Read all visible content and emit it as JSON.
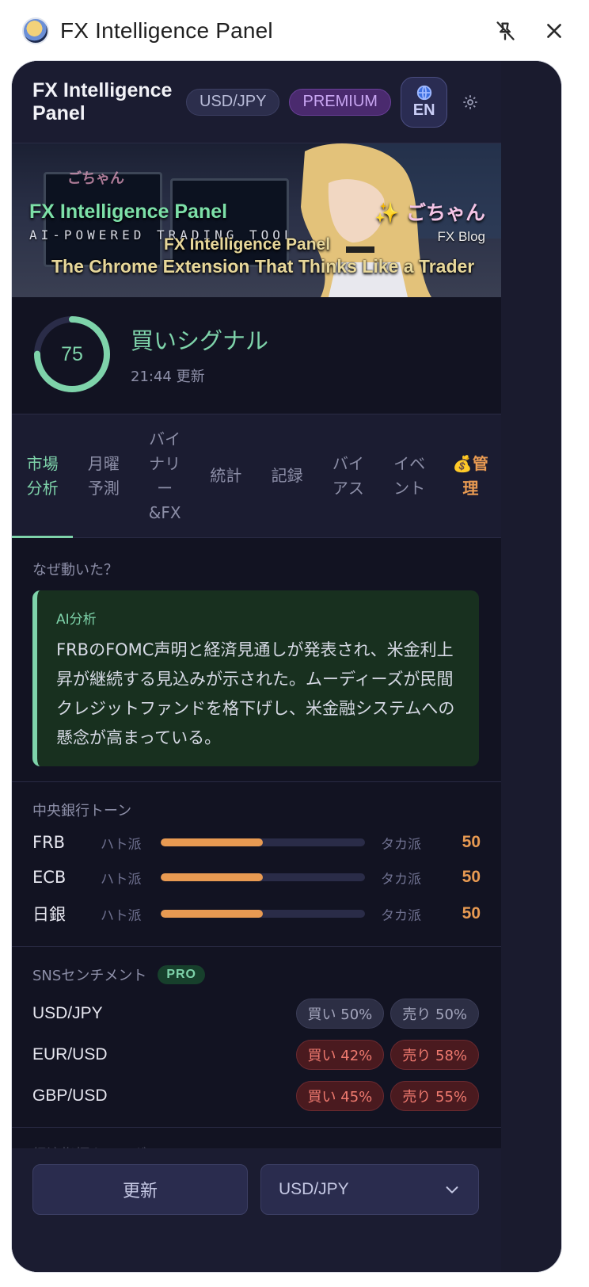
{
  "chrome": {
    "title": "FX Intelligence Panel"
  },
  "header": {
    "title": "FX Intelligence Panel",
    "pair_badge": "USD/JPY",
    "plan_badge": "PREMIUM",
    "lang_label": "EN"
  },
  "banner": {
    "title": "FX Intelligence Panel",
    "subtitle": "AI-POWERED TRADING TOOL",
    "overlay_title": "FX Intelligence Panel",
    "tagline": "The Chrome Extension That Thinks Like a Trader",
    "brand": "✨ ごちゃん",
    "brand_small": "ごちゃん",
    "blog": "FX Blog"
  },
  "signal": {
    "score": "75",
    "score_value": 75,
    "label": "買いシグナル",
    "updated": "21:44 更新",
    "color": "#7ed3aa"
  },
  "tabs": [
    {
      "label": "市場\n分析"
    },
    {
      "label": "月曜\n予測"
    },
    {
      "label": "バイ\nナリ\nー\n&FX"
    },
    {
      "label": "統計"
    },
    {
      "label": "記録"
    },
    {
      "label": "バイ\nアス"
    },
    {
      "label": "イベ\nント"
    },
    {
      "label": "💰管\n理"
    }
  ],
  "why": {
    "label": "なぜ動いた？",
    "ai_head": "AI分析",
    "ai_text": "FRBのFOMC声明と経済見通しが発表され、米金利上昇が継続する見込みが示された。ムーディーズが民間クレジットファンドを格下げし、米金融システムへの懸念が高まっている。"
  },
  "central_banks": {
    "label": "中央銀行トーン",
    "rows": [
      {
        "name": "FRB",
        "dove": "ハト派",
        "hawk": "タカ派",
        "value": "50",
        "level": 0.5
      },
      {
        "name": "ECB",
        "dove": "ハト派",
        "hawk": "タカ派",
        "value": "50",
        "level": 0.5
      },
      {
        "name": "日銀",
        "dove": "ハト派",
        "hawk": "タカ派",
        "value": "50",
        "level": 0.5
      }
    ]
  },
  "sns": {
    "label": "SNSセンチメント",
    "badge": "PRO",
    "rows": [
      {
        "pair": "USD/JPY",
        "buy": "買い 50%",
        "sell": "売り 50%",
        "tone": "neutral"
      },
      {
        "pair": "EUR/USD",
        "buy": "買い 42%",
        "sell": "売り 58%",
        "tone": "red"
      },
      {
        "pair": "GBP/USD",
        "buy": "買い 45%",
        "sell": "売り 55%",
        "tone": "red"
      }
    ]
  },
  "next_section_label": "経済指標カレンダー",
  "footer": {
    "refresh_label": "更新",
    "pair_select": "USD/JPY"
  },
  "colors": {
    "accent": "#7ed3aa",
    "warning": "#e89a52",
    "premium": "#c9a6f2"
  }
}
